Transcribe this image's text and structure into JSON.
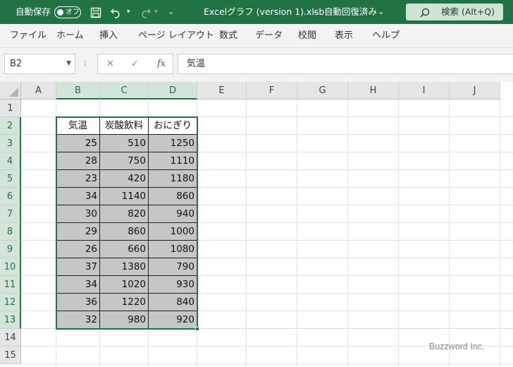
{
  "titlebar": {
    "autosave_label": "自動保存",
    "toggle_state": "オフ",
    "document_title": "Excelグラフ (version 1).xlsb",
    "separator": "-",
    "save_status": "自動回復済み",
    "save_status_caret": "⌄",
    "search_placeholder": "検索 (Alt+Q)",
    "customize_glyph": "⌄"
  },
  "ribbon": {
    "tabs": [
      "ファイル",
      "ホーム",
      "挿入",
      "ページ レイアウト",
      "数式",
      "データ",
      "校閲",
      "表示",
      "ヘルプ"
    ]
  },
  "formula_bar": {
    "name_box": "B2",
    "cancel_glyph": "✕",
    "enter_glyph": "✓",
    "fx_label": "fx",
    "formula_value": "気温"
  },
  "sheet": {
    "columns": [
      "A",
      "B",
      "C",
      "D",
      "E",
      "F",
      "G",
      "H",
      "I",
      "J"
    ],
    "rows": [
      "1",
      "2",
      "3",
      "4",
      "5",
      "6",
      "7",
      "8",
      "9",
      "10",
      "11",
      "12",
      "13",
      "14",
      "15"
    ],
    "selected_columns": [
      "B",
      "C",
      "D"
    ],
    "selected_rows": [
      "2",
      "3",
      "4",
      "5",
      "6",
      "7",
      "8",
      "9",
      "10",
      "11",
      "12",
      "13"
    ],
    "table_headers": [
      "気温",
      "炭酸飲料",
      "おにぎり"
    ],
    "table_rows": [
      [
        "25",
        "510",
        "1250"
      ],
      [
        "28",
        "750",
        "1110"
      ],
      [
        "23",
        "420",
        "1180"
      ],
      [
        "34",
        "1140",
        "860"
      ],
      [
        "30",
        "820",
        "940"
      ],
      [
        "29",
        "860",
        "1000"
      ],
      [
        "26",
        "660",
        "1080"
      ],
      [
        "37",
        "1380",
        "790"
      ],
      [
        "34",
        "1020",
        "930"
      ],
      [
        "36",
        "1220",
        "840"
      ],
      [
        "32",
        "980",
        "920"
      ]
    ]
  },
  "watermark": "Buzzword Inc.",
  "colors": {
    "accent": "#217346",
    "selection_fill": "#c6c6c6",
    "header_selected": "#d3e5d9"
  },
  "icons": [
    "save-icon",
    "undo-icon",
    "redo-icon",
    "customize-icon",
    "search-icon",
    "cancel-icon",
    "enter-icon",
    "function-icon"
  ]
}
